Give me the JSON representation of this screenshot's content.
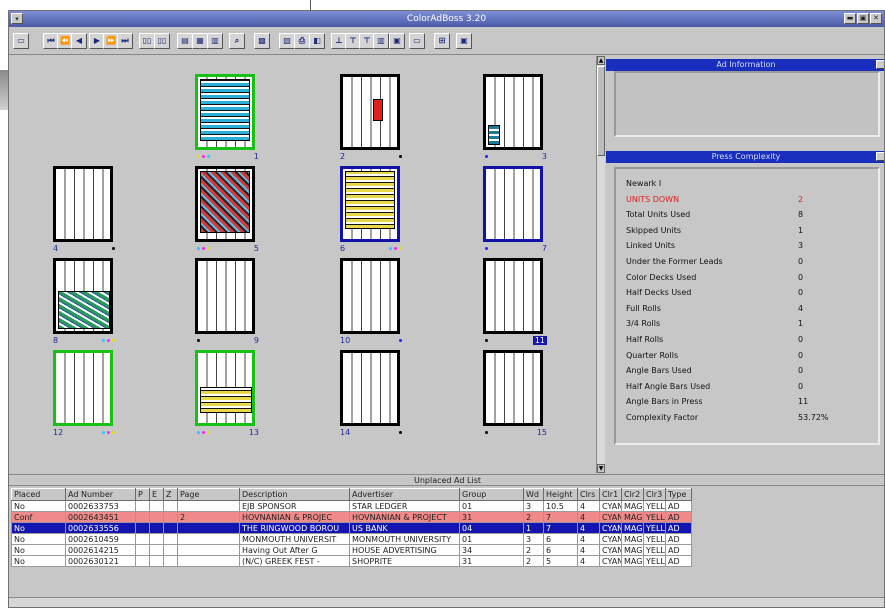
{
  "window": {
    "title": "ColorAdBoss 3.20"
  },
  "titlebar": {
    "system_button": "▾",
    "buttons": [
      "▬",
      "▣",
      "✕"
    ]
  },
  "toolbar": {
    "buttons": [
      {
        "name": "open-button",
        "glyph": "▭"
      },
      {
        "name": "first-page-button",
        "glyph": "⏮"
      },
      {
        "name": "rewind-button",
        "glyph": "⏪"
      },
      {
        "name": "prev-page-button",
        "glyph": "◀"
      },
      {
        "name": "next-page-button",
        "glyph": "▶"
      },
      {
        "name": "fast-forward-button",
        "glyph": "⏩"
      },
      {
        "name": "last-page-button",
        "glyph": "⏭"
      },
      {
        "name": "spread-left-button",
        "glyph": "▯▯"
      },
      {
        "name": "spread-right-button",
        "glyph": "▯▯"
      },
      {
        "name": "view-one-button",
        "glyph": "▤"
      },
      {
        "name": "view-two-button",
        "glyph": "▦"
      },
      {
        "name": "view-three-button",
        "glyph": "▥"
      },
      {
        "name": "search-button",
        "glyph": "⌕"
      },
      {
        "name": "color-button",
        "glyph": "▩"
      },
      {
        "name": "tool-a-button",
        "glyph": "▧"
      },
      {
        "name": "print-button",
        "glyph": "⎙"
      },
      {
        "name": "tool-b-button",
        "glyph": "◧"
      },
      {
        "name": "align-a-button",
        "glyph": "⊥"
      },
      {
        "name": "align-b-button",
        "glyph": "⊤"
      },
      {
        "name": "align-c-button",
        "glyph": "⊤"
      },
      {
        "name": "align-d-button",
        "glyph": "▥"
      },
      {
        "name": "tool-c-button",
        "glyph": "▣"
      },
      {
        "name": "tool-d-button",
        "glyph": "▭"
      },
      {
        "name": "grid-button",
        "glyph": "⊞"
      },
      {
        "name": "tool-e-button",
        "glyph": "▣"
      }
    ]
  },
  "pages": [
    {
      "num": "1",
      "num_side": "right",
      "dots": [
        "#e4e400",
        "#ff22ff",
        "#22ccff"
      ],
      "frame": "green",
      "ad": "blue"
    },
    {
      "num": "2",
      "num_side": "left",
      "dots": [
        "#000000"
      ],
      "frame": "black",
      "ad": "solidred"
    },
    {
      "num": "3",
      "num_side": "right",
      "dots": [
        "#2222ff"
      ],
      "frame": "black",
      "ad": "teal"
    },
    {
      "num": "4",
      "num_side": "left",
      "dots": [
        "#000000"
      ],
      "frame": "black",
      "ad": ""
    },
    {
      "num": "5",
      "num_side": "right",
      "dots": [
        "#22ccff",
        "#ff22ff",
        "#e4e400"
      ],
      "frame": "black",
      "ad": "red"
    },
    {
      "num": "6",
      "num_side": "left",
      "dots": [
        "#22ccff",
        "#ff22ff",
        "#e4e400"
      ],
      "frame": "blue",
      "ad": "yel"
    },
    {
      "num": "7",
      "num_side": "right",
      "dots": [
        "#2222ff"
      ],
      "frame": "blue",
      "ad": ""
    },
    {
      "num": "8",
      "num_side": "left",
      "dots": [
        "#22ccff",
        "#ff22ff",
        "#e4e400"
      ],
      "frame": "black",
      "ad": "grn"
    },
    {
      "num": "9",
      "num_side": "right",
      "dots": [
        "#000000"
      ],
      "frame": "black",
      "ad": ""
    },
    {
      "num": "10",
      "num_side": "left",
      "dots": [
        "#2222ff"
      ],
      "frame": "black",
      "ad": ""
    },
    {
      "num": "11",
      "num_side": "right",
      "selected": true,
      "dots": [
        "#000000"
      ],
      "frame": "black",
      "ad": ""
    },
    {
      "num": "12",
      "num_side": "left",
      "dots": [
        "#22ccff",
        "#ff22ff",
        "#e4e400"
      ],
      "frame": "green",
      "ad": ""
    },
    {
      "num": "13",
      "num_side": "right",
      "dots": [
        "#22ccff",
        "#ff22ff",
        "#e4e400"
      ],
      "frame": "green",
      "ad": "yel"
    },
    {
      "num": "14",
      "num_side": "left",
      "dots": [
        "#000000"
      ],
      "frame": "black",
      "ad": ""
    },
    {
      "num": "15",
      "num_side": "right",
      "dots": [
        "#000000"
      ],
      "frame": "black",
      "ad": ""
    }
  ],
  "ad_information": {
    "title": "Ad Information"
  },
  "press_complexity": {
    "title": "Press Complexity",
    "rows": [
      {
        "label": "Newark I",
        "value": ""
      },
      {
        "label": "UNITS DOWN",
        "value": "2",
        "highlight": true
      },
      {
        "label": "Total Units Used",
        "value": "8"
      },
      {
        "label": "Skipped Units",
        "value": "1"
      },
      {
        "label": "Linked Units",
        "value": "3"
      },
      {
        "label": "Under the Former Leads",
        "value": "0"
      },
      {
        "label": "Color Decks Used",
        "value": "0"
      },
      {
        "label": "Half Decks Used",
        "value": "0"
      },
      {
        "label": "Full Rolls",
        "value": "4"
      },
      {
        "label": "3/4 Rolls",
        "value": "1"
      },
      {
        "label": "Half Rolls",
        "value": "0"
      },
      {
        "label": "Quarter Rolls",
        "value": "0"
      },
      {
        "label": "Angle Bars Used",
        "value": "0"
      },
      {
        "label": "Half Angle Bars Used",
        "value": "0"
      },
      {
        "label": "Angle Bars in Press",
        "value": "11"
      },
      {
        "label": "Complexity Factor",
        "value": "53.72%"
      }
    ]
  },
  "unplaced": {
    "title": "Unplaced Ad List",
    "columns": [
      "Placed",
      "Ad Number",
      "P",
      "E",
      "Z",
      "Page",
      "Description",
      "Advertiser",
      "Group",
      "Wd",
      "Height",
      "Clrs",
      "Clr1",
      "Clr2",
      "Clr3",
      "Type"
    ],
    "rows": [
      {
        "style": "",
        "cells": [
          "No",
          "0002633753",
          "",
          "",
          "",
          "",
          "EJB SPONSOR",
          "STAR LEDGER",
          "01",
          "3",
          "10.5",
          "4",
          "CYAN",
          "MAGE",
          "YELL",
          "AD"
        ]
      },
      {
        "style": "pink",
        "cells": [
          "Conf",
          "0002643451",
          "",
          "",
          "",
          "2",
          "HOVNANIAN & PROJEC",
          "HOVNANIAN & PROJECT",
          "31",
          "2",
          "7",
          "4",
          "CYAN",
          "MAGE",
          "YELL",
          "AD"
        ]
      },
      {
        "style": "sel",
        "cells": [
          "No",
          "0002633556",
          "",
          "",
          "",
          "",
          "THE RINGWOOD BOROU",
          "US BANK",
          "04",
          "1",
          "7",
          "4",
          "CYAN",
          "MAGE",
          "YELL",
          "AD"
        ]
      },
      {
        "style": "",
        "cells": [
          "No",
          "0002610459",
          "",
          "",
          "",
          "",
          "MONMOUTH UNIVERSIT",
          "MONMOUTH UNIVERSITY",
          "01",
          "3",
          "6",
          "4",
          "CYAN",
          "MAGE",
          "YELL",
          "AD"
        ]
      },
      {
        "style": "",
        "cells": [
          "No",
          "0002614215",
          "",
          "",
          "",
          "",
          "Having Out After G",
          "HOUSE ADVERTISING",
          "34",
          "2",
          "6",
          "4",
          "CYAN",
          "MAGE",
          "YELL",
          "AD"
        ]
      },
      {
        "style": "",
        "cells": [
          "No",
          "0002630121",
          "",
          "",
          "",
          "",
          "(N/C) GREEK FEST -",
          "SHOPRITE",
          "31",
          "2",
          "5",
          "4",
          "CYAN",
          "MAGE",
          "YELL",
          "AD"
        ]
      }
    ]
  }
}
